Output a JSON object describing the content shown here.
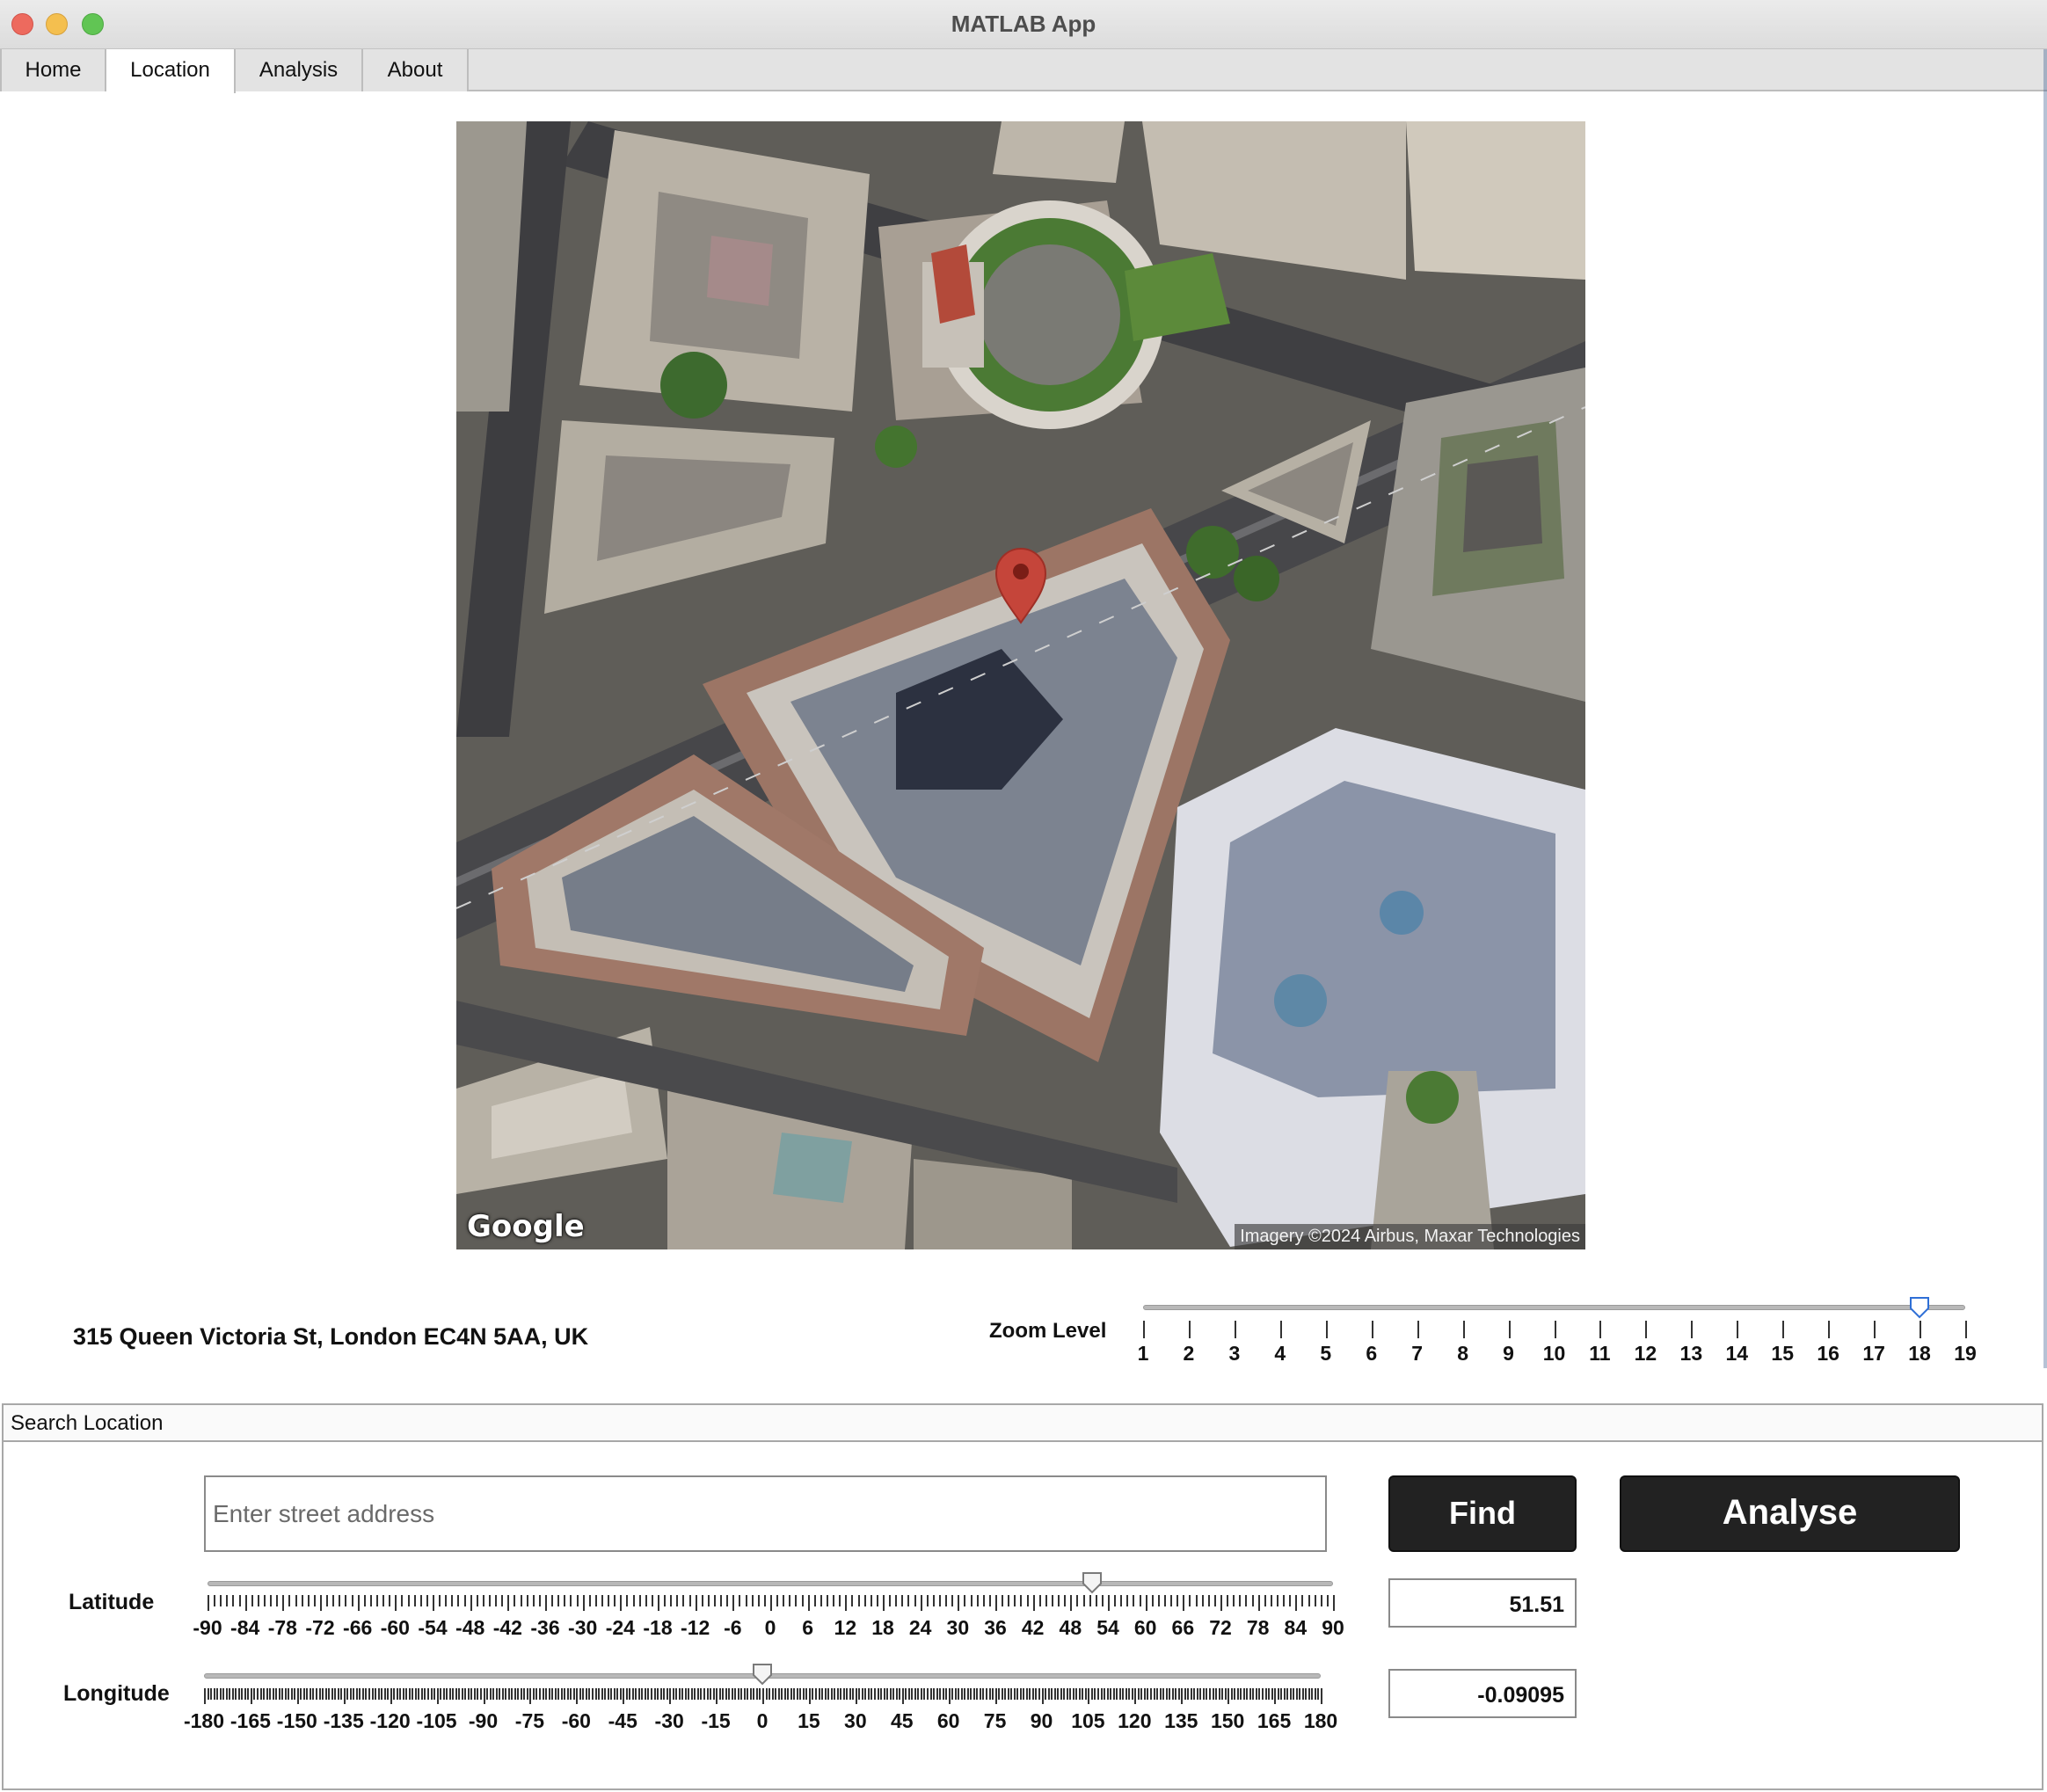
{
  "window": {
    "title": "MATLAB App"
  },
  "tabs": [
    {
      "label": "Home",
      "active": false
    },
    {
      "label": "Location",
      "active": true
    },
    {
      "label": "Analysis",
      "active": false
    },
    {
      "label": "About",
      "active": false
    }
  ],
  "map": {
    "logo": "Google",
    "attribution": "Imagery ©2024 Airbus, Maxar Technologies",
    "marker_icon": "map-pin-icon"
  },
  "location": {
    "address": "315 Queen Victoria St, London EC4N 5AA, UK"
  },
  "zoom": {
    "label": "Zoom Level",
    "min": 1,
    "max": 19,
    "value": 18,
    "ticks": [
      "1",
      "2",
      "3",
      "4",
      "5",
      "6",
      "7",
      "8",
      "9",
      "10",
      "11",
      "12",
      "13",
      "14",
      "15",
      "16",
      "17",
      "18",
      "19"
    ]
  },
  "search": {
    "panel_title": "Search Location",
    "placeholder": "Enter street address",
    "value": "",
    "find_label": "Find",
    "analyse_label": "Analyse"
  },
  "latitude": {
    "label": "Latitude",
    "min": -90,
    "max": 90,
    "value": 51.51,
    "display": "51.51",
    "ticks": [
      "-90",
      "-84",
      "-78",
      "-72",
      "-66",
      "-60",
      "-54",
      "-48",
      "-42",
      "-36",
      "-30",
      "-24",
      "-18",
      "-12",
      "-6",
      "0",
      "6",
      "12",
      "18",
      "24",
      "30",
      "36",
      "42",
      "48",
      "54",
      "60",
      "66",
      "72",
      "78",
      "84",
      "90"
    ]
  },
  "longitude": {
    "label": "Longitude",
    "min": -180,
    "max": 180,
    "value": -0.09095,
    "display": "-0.09095",
    "ticks": [
      "-180",
      "-165",
      "-150",
      "-135",
      "-120",
      "-105",
      "-90",
      "-75",
      "-60",
      "-45",
      "-30",
      "-15",
      "0",
      "15",
      "30",
      "45",
      "60",
      "75",
      "90",
      "105",
      "120",
      "135",
      "150",
      "165",
      "180"
    ]
  },
  "colors": {
    "button_bg": "#222222",
    "marker": "#c5453a",
    "accent": "#2f6fd6"
  }
}
